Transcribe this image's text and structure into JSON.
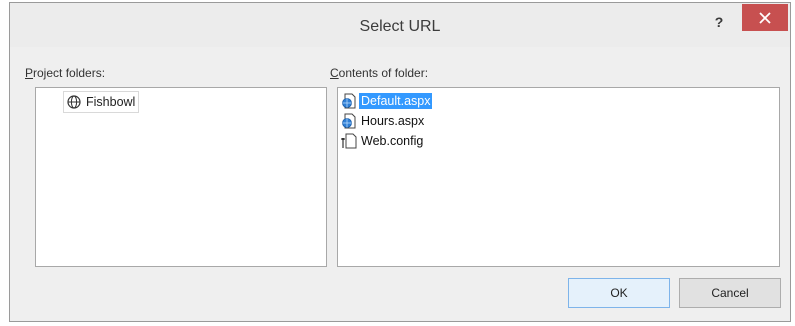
{
  "window": {
    "title": "Select URL",
    "help_label": "?"
  },
  "project_folders": {
    "label_mnemonic": "P",
    "label_rest": "roject folders:",
    "items": [
      {
        "label": "Fishbowl",
        "icon": "globe-icon"
      }
    ]
  },
  "contents": {
    "label_mnemonic": "C",
    "label_rest": "ontents of folder:",
    "files": [
      {
        "label": "Default.aspx",
        "icon": "aspx-page-icon",
        "selected": true
      },
      {
        "label": "Hours.aspx",
        "icon": "aspx-page-icon",
        "selected": false
      },
      {
        "label": "Web.config",
        "icon": "config-file-icon",
        "selected": false
      }
    ]
  },
  "buttons": {
    "ok": "OK",
    "cancel": "Cancel"
  },
  "colors": {
    "close_button": "#c75050",
    "selection": "#3399ff",
    "dialog_bg": "#efefef"
  }
}
